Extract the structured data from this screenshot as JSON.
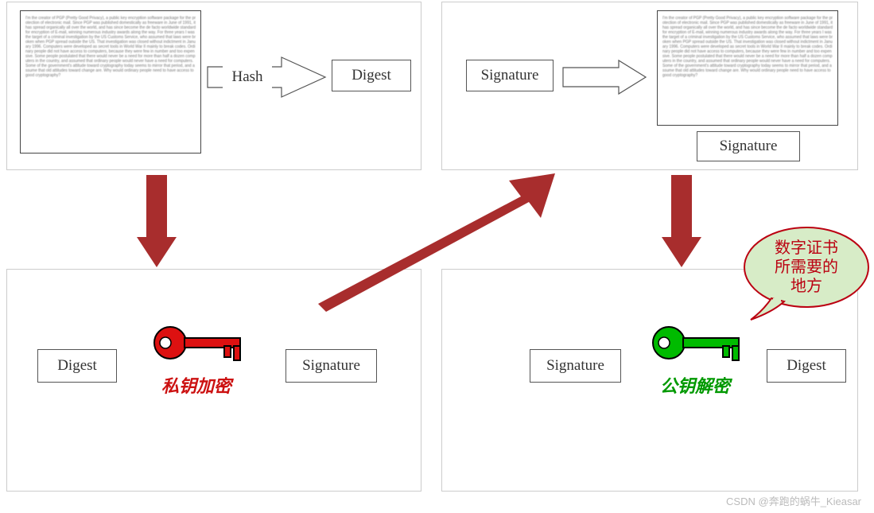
{
  "quadrants": {
    "q1": {
      "hash_label": "Hash",
      "digest_label": "Digest"
    },
    "q2": {
      "signature_label": "Signature",
      "doc_sig_label": "Signature"
    },
    "q3": {
      "digest_label": "Digest",
      "signature_label": "Signature",
      "key_caption": "私钥加密"
    },
    "q4": {
      "signature_label": "Signature",
      "digest_label": "Digest",
      "key_caption": "公钥解密"
    }
  },
  "callout": {
    "line1": "数字证书",
    "line2": "所需要的",
    "line3": "地方"
  },
  "doc_filler": "I'm the creator of PGP (Pretty Good Privacy), a public key encryption software package for the protection of electronic mail. Since PGP was published domestically as freeware in June of 1991, it has spread organically all over the world, and has since become the de facto worldwide standard for encryption of E-mail, winning numerous industry awards along the way. For three years I was the target of a criminal investigation by the US Customs Service, who assumed that laws were broken when PGP spread outside the US. That investigation was closed without indictment in January 1996.\n\nComputers were developed as secret tools in World War II mainly to break codes. Ordinary people did not have access to computers, because they were few in number and too expensive. Some people postulated that there would never be a need for more than half a dozen computers in the country, and assumed that ordinary people would never have a need for computers. Some of the government's attitude toward cryptography today seems to mirror that period, and assume that old attitudes toward change are. Why would ordinary people need to have access to good cryptography?",
  "watermark": "CSDN @奔跑的蜗牛_Kieasar"
}
